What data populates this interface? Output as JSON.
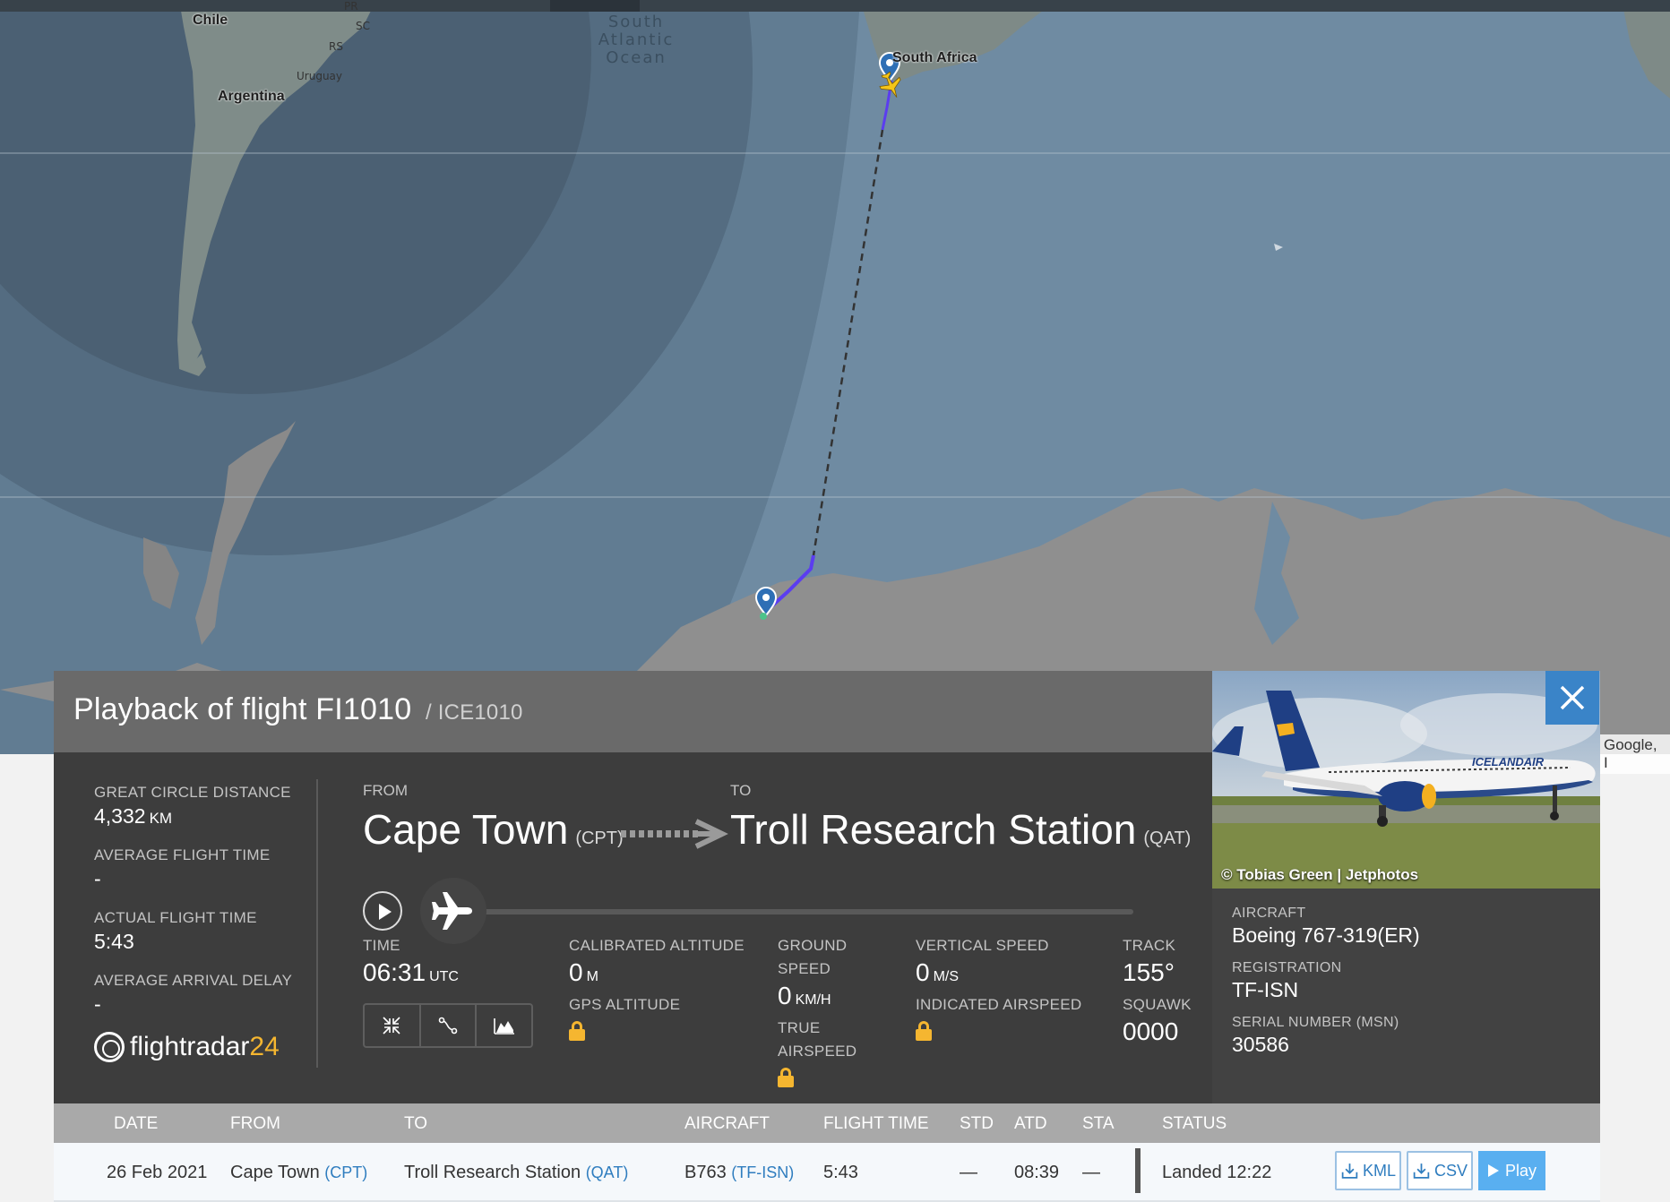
{
  "map": {
    "labels": {
      "chile": "Chile",
      "argentina": "Argentina",
      "uruguay": "Uruguay",
      "rs": "RS",
      "sc": "SC",
      "pr": "PR",
      "south_africa": "South Africa",
      "ocean_line1": "South",
      "ocean_line2": "Atlantic",
      "ocean_line3": "Ocean"
    },
    "attribution": "Google, I"
  },
  "flight": {
    "title_prefix": "Playback of flight",
    "number": "FI1010",
    "callsign_sep": "/",
    "callsign": "ICE1010"
  },
  "stats": {
    "great_circle_label": "Great circle distance",
    "great_circle_value": "4,332",
    "great_circle_unit": "KM",
    "avg_flight_time_label": "Average flight time",
    "avg_flight_time_value": "-",
    "actual_flight_time_label": "Actual flight time",
    "actual_flight_time_value": "5:43",
    "avg_arrival_delay_label": "Average arrival delay",
    "avg_arrival_delay_value": "-"
  },
  "logo": {
    "text_main": "flightradar",
    "text_accent": "24"
  },
  "route": {
    "from_label": "From",
    "from_city": "Cape Town",
    "from_code": "(CPT)",
    "to_label": "To",
    "to_city": "Troll Research Station",
    "to_code": "(QAT)"
  },
  "playback": {
    "progress": 0.0
  },
  "metrics": {
    "time_label": "Time",
    "time_value": "06:31",
    "time_unit": "UTC",
    "cal_alt_label": "Calibrated altitude",
    "cal_alt_value": "0",
    "cal_alt_unit": "M",
    "gps_alt_label": "GPS altitude",
    "ground_speed_label_1": "Ground",
    "ground_speed_label_2": "speed",
    "ground_speed_value": "0",
    "ground_speed_unit": "KM/H",
    "true_airspeed_label_1": "True",
    "true_airspeed_label_2": "airspeed",
    "vertical_speed_label": "Vertical speed",
    "vertical_speed_value": "0",
    "vertical_speed_unit": "M/S",
    "indicated_airspeed_label": "Indicated airspeed",
    "track_label": "Track",
    "track_value": "155°",
    "squawk_label": "Squawk",
    "squawk_value": "0000"
  },
  "aircraft": {
    "photo_credit": "© Tobias Green | Jetphotos",
    "livery_text": "ICELANDAIR",
    "aircraft_label": "Aircraft",
    "aircraft_value": "Boeing 767-319(ER)",
    "registration_label": "Registration",
    "registration_value": "TF-ISN",
    "serial_label": "Serial number (MSN)",
    "serial_value": "30586"
  },
  "table": {
    "headers": {
      "date": "Date",
      "from": "From",
      "to": "To",
      "aircraft": "Aircraft",
      "flight_time": "Flight time",
      "std": "STD",
      "atd": "ATD",
      "sta": "STA",
      "status": "Status"
    },
    "row": {
      "date": "26 Feb 2021",
      "from_city": "Cape Town",
      "from_code": "(CPT)",
      "to_city": "Troll Research Station",
      "to_code": "(QAT)",
      "aircraft_type": "B763",
      "aircraft_reg": "(TF-ISN)",
      "flight_time": "5:43",
      "std": "—",
      "atd": "08:39",
      "sta": "—",
      "status": "Landed 12:22",
      "kml_label": "KML",
      "csv_label": "CSV",
      "play_label": "Play"
    }
  },
  "colors": {
    "accent_blue": "#3a84c8",
    "lock_yellow": "#f5b630",
    "track_purple": "#5b3df0"
  }
}
